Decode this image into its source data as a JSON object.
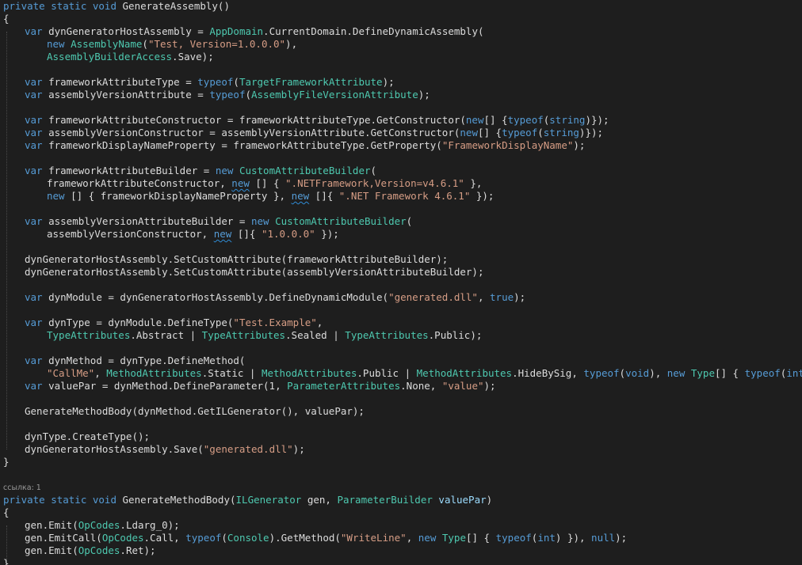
{
  "editor": {
    "theme_colors": {
      "background": "#1e1e1e",
      "keyword": "#569cd6",
      "type": "#4ec9b0",
      "string": "#d69d85",
      "identifier": "#dcdcdc",
      "parameter": "#9cdcfe"
    },
    "codelens": {
      "references_label": "ссылка: 1"
    },
    "lines": [
      {
        "indent": 0,
        "tokens": [
          [
            "kw",
            "private static void "
          ],
          [
            "pl",
            "GenerateAssembly()"
          ]
        ]
      },
      {
        "indent": 0,
        "tokens": [
          [
            "pl",
            "{"
          ]
        ]
      },
      {
        "indent": 1,
        "tokens": [
          [
            "kw",
            "var "
          ],
          [
            "pl",
            "dynGeneratorHostAssembly = "
          ],
          [
            "ty",
            "AppDomain"
          ],
          [
            "pl",
            ".CurrentDomain.DefineDynamicAssembly("
          ]
        ]
      },
      {
        "indent": 2,
        "tokens": [
          [
            "kw",
            "new "
          ],
          [
            "ty",
            "AssemblyName"
          ],
          [
            "pl",
            "("
          ],
          [
            "st",
            "\"Test, Version=1.0.0.0\""
          ],
          [
            "pl",
            "),"
          ]
        ]
      },
      {
        "indent": 2,
        "tokens": [
          [
            "ty",
            "AssemblyBuilderAccess"
          ],
          [
            "pl",
            ".Save);"
          ]
        ]
      },
      {
        "indent": 0,
        "tokens": []
      },
      {
        "indent": 1,
        "tokens": [
          [
            "kw",
            "var "
          ],
          [
            "pl",
            "frameworkAttributeType = "
          ],
          [
            "kw",
            "typeof"
          ],
          [
            "pl",
            "("
          ],
          [
            "ty",
            "TargetFrameworkAttribute"
          ],
          [
            "pl",
            ");"
          ]
        ]
      },
      {
        "indent": 1,
        "tokens": [
          [
            "kw",
            "var "
          ],
          [
            "pl",
            "assemblyVersionAttribute = "
          ],
          [
            "kw",
            "typeof"
          ],
          [
            "pl",
            "("
          ],
          [
            "ty",
            "AssemblyFileVersionAttribute"
          ],
          [
            "pl",
            ");"
          ]
        ]
      },
      {
        "indent": 0,
        "tokens": []
      },
      {
        "indent": 1,
        "tokens": [
          [
            "kw",
            "var "
          ],
          [
            "pl",
            "frameworkAttributeConstructor = frameworkAttributeType.GetConstructor("
          ],
          [
            "kw",
            "new"
          ],
          [
            "pl",
            "[] {"
          ],
          [
            "kw",
            "typeof"
          ],
          [
            "pl",
            "("
          ],
          [
            "kw",
            "string"
          ],
          [
            "pl",
            ")});"
          ]
        ]
      },
      {
        "indent": 1,
        "tokens": [
          [
            "kw",
            "var "
          ],
          [
            "pl",
            "assemblyVersionConstructor = assemblyVersionAttribute.GetConstructor("
          ],
          [
            "kw",
            "new"
          ],
          [
            "pl",
            "[] {"
          ],
          [
            "kw",
            "typeof"
          ],
          [
            "pl",
            "("
          ],
          [
            "kw",
            "string"
          ],
          [
            "pl",
            ")});"
          ]
        ]
      },
      {
        "indent": 1,
        "tokens": [
          [
            "kw",
            "var "
          ],
          [
            "pl",
            "frameworkDisplayNameProperty = frameworkAttributeType.GetProperty("
          ],
          [
            "st",
            "\"FrameworkDisplayName\""
          ],
          [
            "pl",
            ");"
          ]
        ]
      },
      {
        "indent": 0,
        "tokens": []
      },
      {
        "indent": 1,
        "tokens": [
          [
            "kw",
            "var "
          ],
          [
            "pl",
            "frameworkAttributeBuilder = "
          ],
          [
            "kw",
            "new "
          ],
          [
            "ty",
            "CustomAttributeBuilder"
          ],
          [
            "pl",
            "("
          ]
        ]
      },
      {
        "indent": 2,
        "tokens": [
          [
            "pl",
            "frameworkAttributeConstructor, "
          ],
          [
            "kws",
            "new"
          ],
          [
            "pl",
            " [] { "
          ],
          [
            "st",
            "\".NETFramework,Version=v4.6.1\""
          ],
          [
            "pl",
            " },"
          ]
        ]
      },
      {
        "indent": 2,
        "tokens": [
          [
            "kw",
            "new "
          ],
          [
            "pl",
            "[] { frameworkDisplayNameProperty }, "
          ],
          [
            "kws",
            "new"
          ],
          [
            "pl",
            " []{ "
          ],
          [
            "st",
            "\".NET Framework 4.6.1\""
          ],
          [
            "pl",
            " });"
          ]
        ]
      },
      {
        "indent": 0,
        "tokens": []
      },
      {
        "indent": 1,
        "tokens": [
          [
            "kw",
            "var "
          ],
          [
            "pl",
            "assemblyVersionAttributeBuilder = "
          ],
          [
            "kw",
            "new "
          ],
          [
            "ty",
            "CustomAttributeBuilder"
          ],
          [
            "pl",
            "("
          ]
        ]
      },
      {
        "indent": 2,
        "tokens": [
          [
            "pl",
            "assemblyVersionConstructor, "
          ],
          [
            "kws",
            "new"
          ],
          [
            "pl",
            " []{ "
          ],
          [
            "st",
            "\"1.0.0.0\""
          ],
          [
            "pl",
            " });"
          ]
        ]
      },
      {
        "indent": 0,
        "tokens": []
      },
      {
        "indent": 1,
        "tokens": [
          [
            "pl",
            "dynGeneratorHostAssembly.SetCustomAttribute(frameworkAttributeBuilder);"
          ]
        ]
      },
      {
        "indent": 1,
        "tokens": [
          [
            "pl",
            "dynGeneratorHostAssembly.SetCustomAttribute(assemblyVersionAttributeBuilder);"
          ]
        ]
      },
      {
        "indent": 0,
        "tokens": []
      },
      {
        "indent": 1,
        "tokens": [
          [
            "kw",
            "var "
          ],
          [
            "pl",
            "dynModule = dynGeneratorHostAssembly.DefineDynamicModule("
          ],
          [
            "st",
            "\"generated.dll\""
          ],
          [
            "pl",
            ", "
          ],
          [
            "kw",
            "true"
          ],
          [
            "pl",
            ");"
          ]
        ]
      },
      {
        "indent": 0,
        "tokens": []
      },
      {
        "indent": 1,
        "tokens": [
          [
            "kw",
            "var "
          ],
          [
            "pl",
            "dynType = dynModule.DefineType("
          ],
          [
            "st",
            "\"Test.Example\""
          ],
          [
            "pl",
            ","
          ]
        ]
      },
      {
        "indent": 2,
        "tokens": [
          [
            "ty",
            "TypeAttributes"
          ],
          [
            "pl",
            ".Abstract | "
          ],
          [
            "ty",
            "TypeAttributes"
          ],
          [
            "pl",
            ".Sealed | "
          ],
          [
            "ty",
            "TypeAttributes"
          ],
          [
            "pl",
            ".Public);"
          ]
        ]
      },
      {
        "indent": 0,
        "tokens": []
      },
      {
        "indent": 1,
        "tokens": [
          [
            "kw",
            "var "
          ],
          [
            "pl",
            "dynMethod = dynType.DefineMethod("
          ]
        ]
      },
      {
        "indent": 2,
        "tokens": [
          [
            "st",
            "\"CallMe\""
          ],
          [
            "pl",
            ", "
          ],
          [
            "ty",
            "MethodAttributes"
          ],
          [
            "pl",
            ".Static | "
          ],
          [
            "ty",
            "MethodAttributes"
          ],
          [
            "pl",
            ".Public | "
          ],
          [
            "ty",
            "MethodAttributes"
          ],
          [
            "pl",
            ".HideBySig, "
          ],
          [
            "kw",
            "typeof"
          ],
          [
            "pl",
            "("
          ],
          [
            "kw",
            "void"
          ],
          [
            "pl",
            "), "
          ],
          [
            "kw",
            "new "
          ],
          [
            "ty",
            "Type"
          ],
          [
            "pl",
            "[] { "
          ],
          [
            "kw",
            "typeof"
          ],
          [
            "pl",
            "("
          ],
          [
            "kw",
            "int"
          ],
          [
            "pl",
            ") });"
          ]
        ]
      },
      {
        "indent": 1,
        "tokens": [
          [
            "kw",
            "var "
          ],
          [
            "pl",
            "valuePar = dynMethod.DefineParameter(1, "
          ],
          [
            "ty",
            "ParameterAttributes"
          ],
          [
            "pl",
            ".None, "
          ],
          [
            "st",
            "\"value\""
          ],
          [
            "pl",
            ");"
          ]
        ]
      },
      {
        "indent": 0,
        "tokens": []
      },
      {
        "indent": 1,
        "tokens": [
          [
            "pl",
            "GenerateMethodBody(dynMethod.GetILGenerator(), valuePar);"
          ]
        ]
      },
      {
        "indent": 0,
        "tokens": []
      },
      {
        "indent": 1,
        "tokens": [
          [
            "pl",
            "dynType.CreateType();"
          ]
        ]
      },
      {
        "indent": 1,
        "tokens": [
          [
            "pl",
            "dynGeneratorHostAssembly.Save("
          ],
          [
            "st",
            "\"generated.dll\""
          ],
          [
            "pl",
            ");"
          ]
        ]
      },
      {
        "indent": 0,
        "tokens": [
          [
            "pl",
            "}"
          ]
        ]
      },
      {
        "indent": 0,
        "tokens": []
      },
      {
        "lens": true
      },
      {
        "indent": 0,
        "tokens": [
          [
            "kw",
            "private static void "
          ],
          [
            "pl",
            "GenerateMethodBody("
          ],
          [
            "ty",
            "ILGenerator"
          ],
          [
            "pl",
            " gen, "
          ],
          [
            "ty",
            "ParameterBuilder"
          ],
          [
            "pn",
            " valuePar"
          ],
          [
            "pl",
            ")"
          ]
        ]
      },
      {
        "indent": 0,
        "tokens": [
          [
            "pl",
            "{"
          ]
        ]
      },
      {
        "indent": 1,
        "tokens": [
          [
            "pl",
            "gen.Emit("
          ],
          [
            "ty",
            "OpCodes"
          ],
          [
            "pl",
            ".Ldarg_0);"
          ]
        ]
      },
      {
        "indent": 1,
        "tokens": [
          [
            "pl",
            "gen.EmitCall("
          ],
          [
            "ty",
            "OpCodes"
          ],
          [
            "pl",
            ".Call, "
          ],
          [
            "kw",
            "typeof"
          ],
          [
            "pl",
            "("
          ],
          [
            "ty",
            "Console"
          ],
          [
            "pl",
            ").GetMethod("
          ],
          [
            "st",
            "\"WriteLine\""
          ],
          [
            "pl",
            ", "
          ],
          [
            "kw",
            "new "
          ],
          [
            "ty",
            "Type"
          ],
          [
            "pl",
            "[] { "
          ],
          [
            "kw",
            "typeof"
          ],
          [
            "pl",
            "("
          ],
          [
            "kw",
            "int"
          ],
          [
            "pl",
            ") }), "
          ],
          [
            "kw",
            "null"
          ],
          [
            "pl",
            ");"
          ]
        ]
      },
      {
        "indent": 1,
        "tokens": [
          [
            "pl",
            "gen.Emit("
          ],
          [
            "ty",
            "OpCodes"
          ],
          [
            "pl",
            ".Ret);"
          ]
        ]
      },
      {
        "indent": 0,
        "tokens": [
          [
            "pl",
            "}"
          ]
        ]
      }
    ]
  }
}
